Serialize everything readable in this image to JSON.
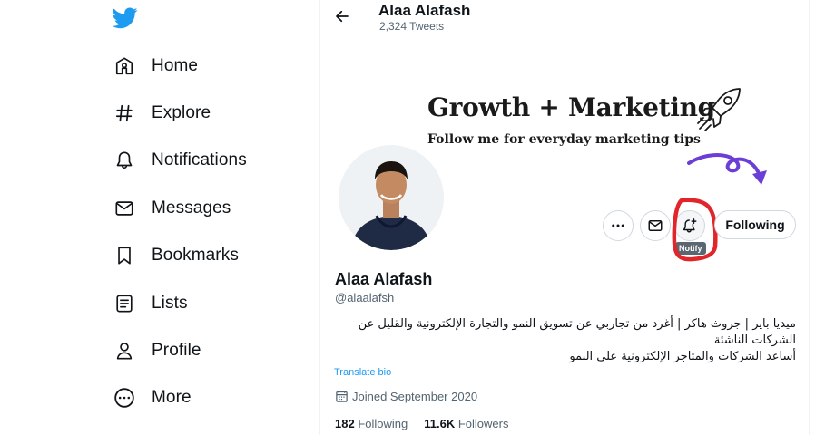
{
  "colors": {
    "brand": "#1d9bf0",
    "text": "#0f1419",
    "muted": "#536471",
    "highlight": "#e0262b",
    "arrow": "#6b3fd6"
  },
  "sidebar": {
    "logo": "twitter-bird-icon",
    "items": [
      {
        "label": "Home",
        "icon": "home-icon"
      },
      {
        "label": "Explore",
        "icon": "hashtag-icon"
      },
      {
        "label": "Notifications",
        "icon": "bell-icon"
      },
      {
        "label": "Messages",
        "icon": "envelope-icon"
      },
      {
        "label": "Bookmarks",
        "icon": "bookmark-icon"
      },
      {
        "label": "Lists",
        "icon": "list-icon"
      },
      {
        "label": "Profile",
        "icon": "person-icon"
      },
      {
        "label": "More",
        "icon": "more-circle-icon"
      }
    ]
  },
  "header": {
    "name": "Alaa Alafash",
    "tweet_count": "2,324 Tweets"
  },
  "banner": {
    "title": "Growth + Marketing",
    "subtitle": "Follow me for everyday marketing tips"
  },
  "actions": {
    "follow_label": "Following",
    "notify_tooltip": "Notify"
  },
  "profile": {
    "name": "Alaa Alafash",
    "handle": "@alaalafsh",
    "bio_lines": [
      "ميديا باير | جروث هاكر | أغرد من تجاربي عن تسويق النمو والتجارة الإلكترونية والقليل عن الشركات الناشئة",
      "أساعد الشركات والمتاجر الإلكترونية على النمو"
    ],
    "translate_label": "Translate bio",
    "joined": "Joined September 2020",
    "following_count": "182",
    "following_label": "Following",
    "followers_count": "11.6K",
    "followers_label": "Followers"
  }
}
